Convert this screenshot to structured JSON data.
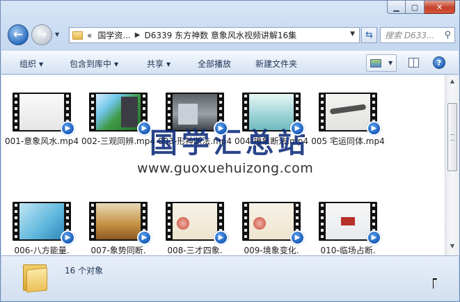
{
  "window": {
    "caption_buttons": {
      "minimize": "▁",
      "maximize": "▢",
      "close": "✕"
    }
  },
  "nav": {
    "back_icon": "back-arrow-icon",
    "forward_icon": "forward-arrow-icon",
    "breadcrumb": [
      "«",
      "国学资...",
      "D6339 东方神数 意象风水视频讲解16集"
    ],
    "search_placeholder": "搜索 D633..."
  },
  "toolbar": {
    "organize": "组织",
    "include_in_library": "包含到库中",
    "share": "共享",
    "play_all": "全部播放",
    "new_folder": "新建文件夹",
    "help": "?"
  },
  "files": [
    {
      "name": "001-意象风水.mp4",
      "thumb": "white"
    },
    {
      "name": "002-三观同辨.mp4",
      "thumb": "green"
    },
    {
      "name": "003-形神断法.mp4",
      "thumb": "grey"
    },
    {
      "name": "004-撞象断法.mp4",
      "thumb": "teal"
    },
    {
      "name": "005 宅运同体.mp4",
      "thumb": "ink"
    },
    {
      "name": "006-八方能量.",
      "thumb": "blue"
    },
    {
      "name": "007-象势同断.",
      "thumb": "gold"
    },
    {
      "name": "008-三才四象.",
      "thumb": "flower"
    },
    {
      "name": "009-境象变化.",
      "thumb": "flower"
    },
    {
      "name": "010-临场占断.",
      "thumb": "seal"
    }
  ],
  "watermark": {
    "title": "国学汇总站",
    "url": "www.guoxuehuizong.com"
  },
  "details": {
    "count": "16 个对象"
  }
}
